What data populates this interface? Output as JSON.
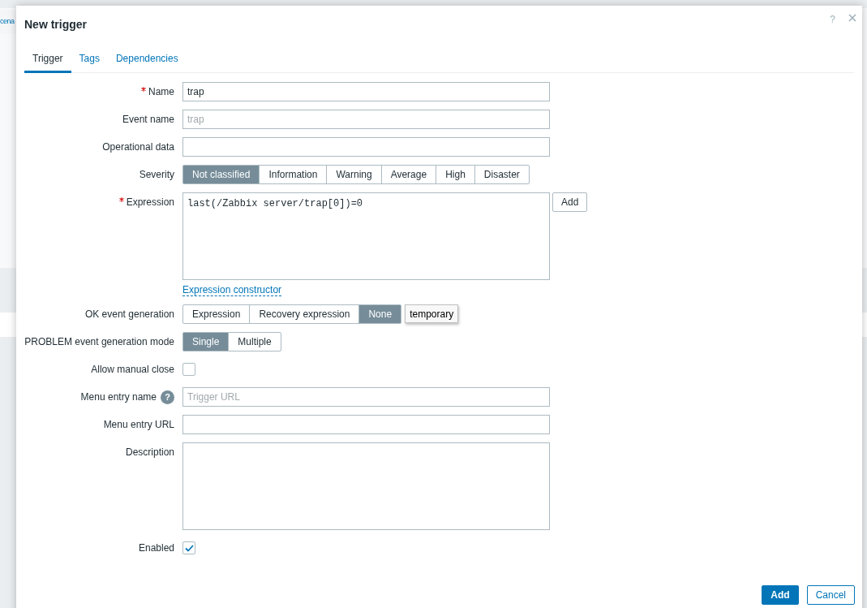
{
  "background": {
    "text": "cena"
  },
  "dialog": {
    "title": "New trigger",
    "help": "?"
  },
  "tabs": [
    {
      "label": "Trigger",
      "selected": true
    },
    {
      "label": "Tags",
      "selected": false
    },
    {
      "label": "Dependencies",
      "selected": false
    }
  ],
  "form": [
    {
      "kind": "text",
      "label": "Name",
      "required": true,
      "value": "trap"
    },
    {
      "kind": "text",
      "label": "Event name",
      "required": false,
      "placeholder": "trap"
    },
    {
      "kind": "text",
      "label": "Operational data",
      "required": false
    },
    {
      "kind": "segmented",
      "label": "Severity",
      "required": false,
      "options": [
        {
          "label": "Not classified",
          "selected": true
        },
        {
          "label": "Information",
          "selected": false
        },
        {
          "label": "Warning",
          "selected": false
        },
        {
          "label": "Average",
          "selected": false
        },
        {
          "label": "High",
          "selected": false
        },
        {
          "label": "Disaster",
          "selected": false
        }
      ]
    },
    {
      "kind": "expression",
      "label": "Expression",
      "required": true,
      "value": "last(/Zabbix server/trap[0])=0",
      "button": "Add",
      "link": "Expression constructor"
    },
    {
      "kind": "segmented",
      "label": "OK event generation",
      "required": false,
      "options": [
        {
          "label": "Expression",
          "selected": false
        },
        {
          "label": "Recovery expression",
          "selected": false
        },
        {
          "label": "None",
          "selected": true
        }
      ],
      "tooltip": "temporary"
    },
    {
      "kind": "segmented",
      "label": "PROBLEM event generation mode",
      "required": false,
      "options": [
        {
          "label": "Single",
          "selected": true
        },
        {
          "label": "Multiple",
          "selected": false
        }
      ]
    },
    {
      "kind": "checkbox",
      "label": "Allow manual close",
      "required": false,
      "checked": false
    },
    {
      "kind": "text",
      "label": "Menu entry name",
      "required": false,
      "help": "?",
      "placeholder": "Trigger URL"
    },
    {
      "kind": "text",
      "label": "Menu entry URL",
      "required": false
    },
    {
      "kind": "textarea",
      "label": "Description",
      "required": false
    },
    {
      "kind": "checkbox",
      "label": "Enabled",
      "required": false,
      "checked": true
    }
  ],
  "footer_buttons": [
    {
      "label": "Add",
      "primary": true
    },
    {
      "label": "Cancel",
      "primary": false
    }
  ]
}
